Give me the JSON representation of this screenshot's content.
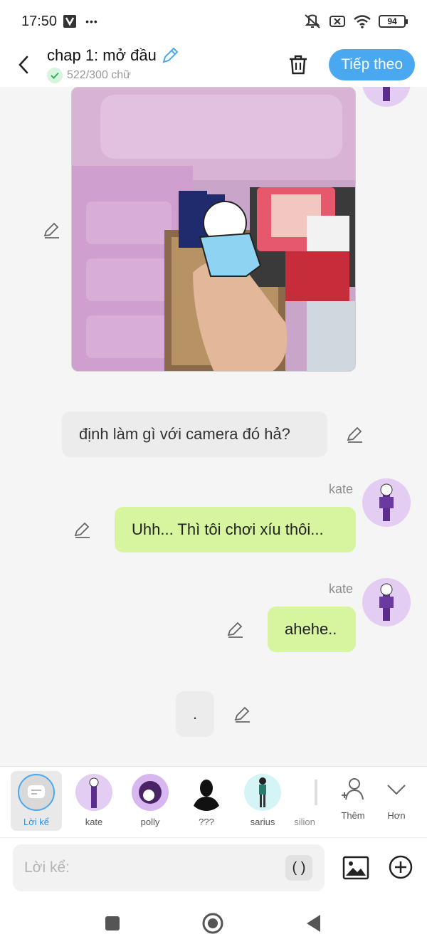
{
  "status_bar": {
    "time": "17:50",
    "dots": "•••",
    "battery": "94"
  },
  "header": {
    "title": "chap 1: mở đầu",
    "word_count": "522/300 chữ",
    "next_label": "Tiếp theo"
  },
  "messages": [
    {
      "type": "image",
      "description_icon": "photo"
    },
    {
      "type": "narration",
      "text": "định làm gì với camera đó hả?"
    },
    {
      "type": "character",
      "sender": "kate",
      "text": "Uhh... Thì tôi chơi xíu thôi..."
    },
    {
      "type": "character",
      "sender": "kate",
      "text": "ahehe.."
    },
    {
      "type": "narration",
      "text": "."
    }
  ],
  "characters": [
    {
      "label": "Lời kể",
      "selected": true
    },
    {
      "label": "kate"
    },
    {
      "label": "polly"
    },
    {
      "label": "???"
    },
    {
      "label": "sarius"
    },
    {
      "label": "silion"
    }
  ],
  "char_actions": {
    "add_label": "Thêm",
    "more_label": "Hơn"
  },
  "input": {
    "placeholder": "Lời kể:",
    "paren_label": "( )"
  },
  "colors": {
    "accent": "#4aa8f0",
    "user_bubble": "#d7f49e",
    "narration_bubble": "#ececec",
    "avatar_bg": "#e4cdf2"
  }
}
